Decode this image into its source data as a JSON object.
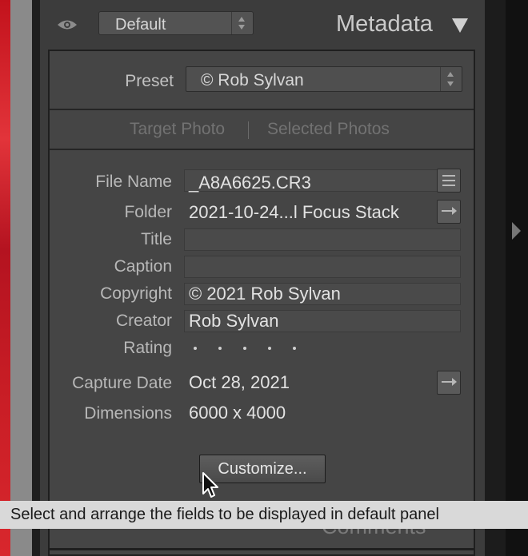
{
  "header": {
    "preset_dropdown_value": "Default",
    "panel_title": "Metadata"
  },
  "preset": {
    "label": "Preset",
    "value": "© Rob Sylvan"
  },
  "target": {
    "target_photo": "Target Photo",
    "selected_photos": "Selected Photos"
  },
  "fields": {
    "file_name": {
      "label": "File Name",
      "value": "_A8A6625.CR3"
    },
    "folder": {
      "label": "Folder",
      "value": "2021-10-24...l Focus Stack"
    },
    "title": {
      "label": "Title",
      "value": ""
    },
    "caption": {
      "label": "Caption",
      "value": ""
    },
    "copyright": {
      "label": "Copyright",
      "value": "© 2021 Rob Sylvan"
    },
    "creator": {
      "label": "Creator",
      "value": "Rob Sylvan"
    },
    "rating": {
      "label": "Rating",
      "stars": 0
    },
    "capture_date": {
      "label": "Capture Date",
      "value": "Oct 28, 2021"
    },
    "dimensions": {
      "label": "Dimensions",
      "value": "6000 x 4000"
    }
  },
  "customize_button": "Customize...",
  "comments_title": "Comments",
  "tooltip": "Select and arrange the fields to be displayed in default panel",
  "colors": {
    "panel_bg": "#3c3c3c",
    "inner_bg": "#454545",
    "tooltip_bg": "#d9d9d9"
  }
}
